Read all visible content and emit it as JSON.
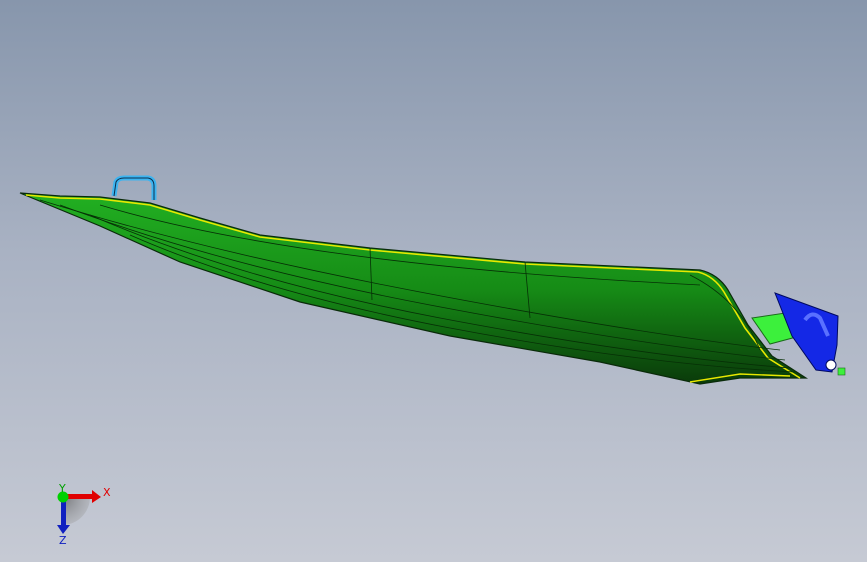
{
  "viewport": {
    "background_top": "#8796ac",
    "background_bottom": "#c6cad4"
  },
  "model": {
    "hull_color": "#1aa01a",
    "edge_highlight_color": "#e8e800",
    "handle_color": "#3cb4f0",
    "bracket_color": "#1428e6",
    "connector_color": "#3cf03c"
  },
  "triad": {
    "x_label": "X",
    "y_label": "Y",
    "z_label": "Z",
    "x_color": "#e00000",
    "y_color": "#00d000",
    "z_color": "#1020c0"
  }
}
